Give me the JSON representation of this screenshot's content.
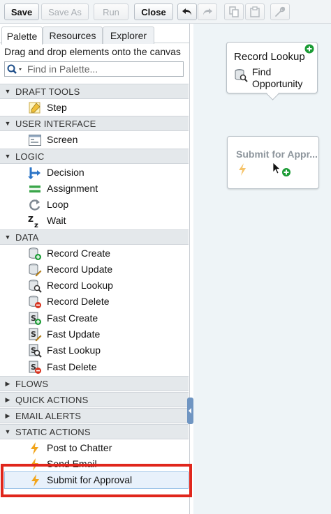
{
  "toolbar": {
    "save": "Save",
    "save_as": "Save As",
    "run": "Run",
    "close": "Close"
  },
  "tabs": [
    "Palette",
    "Resources",
    "Explorer"
  ],
  "palette": {
    "hint": "Drag and drop elements onto the canvas",
    "search_placeholder": "Find in Palette..."
  },
  "sections": {
    "draft_tools": {
      "title": "DRAFT TOOLS",
      "items": [
        "Step"
      ]
    },
    "user_interface": {
      "title": "USER INTERFACE",
      "items": [
        "Screen"
      ]
    },
    "logic": {
      "title": "LOGIC",
      "items": [
        "Decision",
        "Assignment",
        "Loop",
        "Wait"
      ]
    },
    "data": {
      "title": "DATA",
      "items": [
        "Record Create",
        "Record Update",
        "Record Lookup",
        "Record Delete",
        "Fast Create",
        "Fast Update",
        "Fast Lookup",
        "Fast Delete"
      ]
    },
    "flows": {
      "title": "FLOWS"
    },
    "quick_actions": {
      "title": "QUICK ACTIONS"
    },
    "email_alerts": {
      "title": "EMAIL ALERTS"
    },
    "static_actions": {
      "title": "STATIC ACTIONS",
      "items": [
        "Post to Chatter",
        "Send Email",
        "Submit for Approval"
      ]
    }
  },
  "canvas": {
    "node1": {
      "title": "Record Lookup",
      "label": "Find Opportunity"
    },
    "node2": {
      "title": "Submit for Appr..."
    }
  },
  "colors": {
    "highlight": "#e0261c",
    "section_bg": "#e4e8eb",
    "canvas_bg": "#eef4f7",
    "bolt": "#f2a51c",
    "add_green": "#1a9b34"
  },
  "icons": {
    "undo": "undo-icon",
    "redo": "redo-icon",
    "copy": "copy-icon",
    "paste": "paste-icon",
    "wrench": "wrench-icon"
  }
}
